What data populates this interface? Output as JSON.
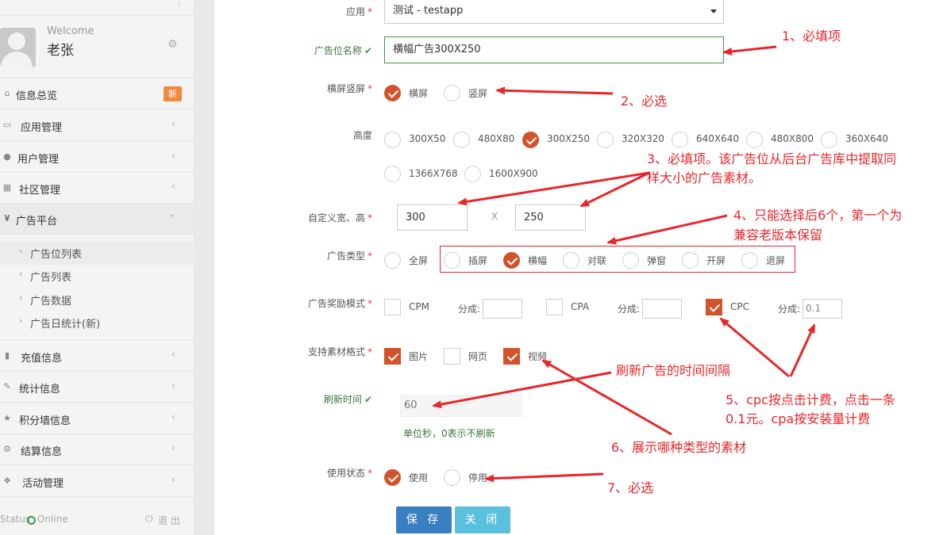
{
  "sidebar": {
    "welcome": "Welcome",
    "username": "老张",
    "menu": [
      {
        "label": "信息总览",
        "badge": "新",
        "icon": "home-icon"
      },
      {
        "label": "应用管理",
        "icon": "monitor-icon"
      },
      {
        "label": "用户管理",
        "icon": "user-icon"
      },
      {
        "label": "社区管理",
        "icon": "grid-icon"
      },
      {
        "label": "广告平台",
        "icon": "yen-icon"
      },
      {
        "label": "充值信息",
        "icon": "bar-chart-icon"
      },
      {
        "label": "统计信息",
        "icon": "edit-icon"
      },
      {
        "label": "积分墙信息",
        "icon": "star-icon"
      },
      {
        "label": "结算信息",
        "icon": "cogs-icon"
      },
      {
        "label": "活动管理",
        "icon": "group-icon"
      }
    ],
    "submenu": [
      "广告位列表",
      "广告列表",
      "广告数据",
      "广告日统计(新)"
    ],
    "status_label": "Status",
    "status_value": "Online",
    "logout": "退 出"
  },
  "form": {
    "app": {
      "label": "应用",
      "value": "测试 - testapp"
    },
    "name": {
      "label": "广告位名称",
      "value": "横幅广告300X250"
    },
    "orientation": {
      "label": "横屏竖屏",
      "options": [
        "横屏",
        "竖屏"
      ],
      "selected": 0
    },
    "height": {
      "label": "高度",
      "options": [
        "300X50",
        "480X80",
        "300X250",
        "320X320",
        "640X640",
        "480X800",
        "360X640",
        "1366X768",
        "1600X900"
      ],
      "selected": 2
    },
    "custom_size": {
      "label": "自定义宽、高",
      "width": "300",
      "separator": "X",
      "height": "250"
    },
    "ad_type": {
      "label": "广告类型",
      "options": [
        "全屏",
        "插屏",
        "横幅",
        "对联",
        "弹窗",
        "开屏",
        "退屏"
      ],
      "selected": 2
    },
    "reward": {
      "label": "广告奖励模式",
      "share_label": "分成:",
      "modes": [
        {
          "name": "CPM",
          "checked": false,
          "share": ""
        },
        {
          "name": "CPA",
          "checked": false,
          "share": ""
        },
        {
          "name": "CPC",
          "checked": true,
          "share": "0.1"
        }
      ]
    },
    "formats": {
      "label": "支持素材格式",
      "options": [
        {
          "name": "图片",
          "checked": true
        },
        {
          "name": "网页",
          "checked": false
        },
        {
          "name": "视频",
          "checked": true
        }
      ]
    },
    "refresh": {
      "label": "刷新时间",
      "value": "60",
      "help": "单位秒，0表示不刷新"
    },
    "status": {
      "label": "使用状态",
      "options": [
        "使用",
        "停用"
      ],
      "selected": 0
    },
    "save": "保 存",
    "close": "关 闭"
  },
  "annotations": {
    "a1": "1、必填项",
    "a2": "2、必选",
    "a3_line1": "3、必填项。该广告位从后台广告库中提取同",
    "a3_line2": "样大小的广告素材。",
    "a4_line1": "4、只能选择后6个，第一个为",
    "a4_line2": "兼容老版本保留",
    "a_refresh": "刷新广告的时间间隔",
    "a5_line1": "5、cpc按点击计费，点击一条",
    "a5_line2": "0.1元。cpa按安装量计费",
    "a6": "6、展示哪种类型的素材",
    "a7": "7、必选",
    "color": "#e8262a"
  },
  "colors": {
    "accent": "#d2532b",
    "save": "#3a7fc1",
    "close": "#5bc0de",
    "badge": "#f0883e",
    "valid": "#3c9a44"
  }
}
